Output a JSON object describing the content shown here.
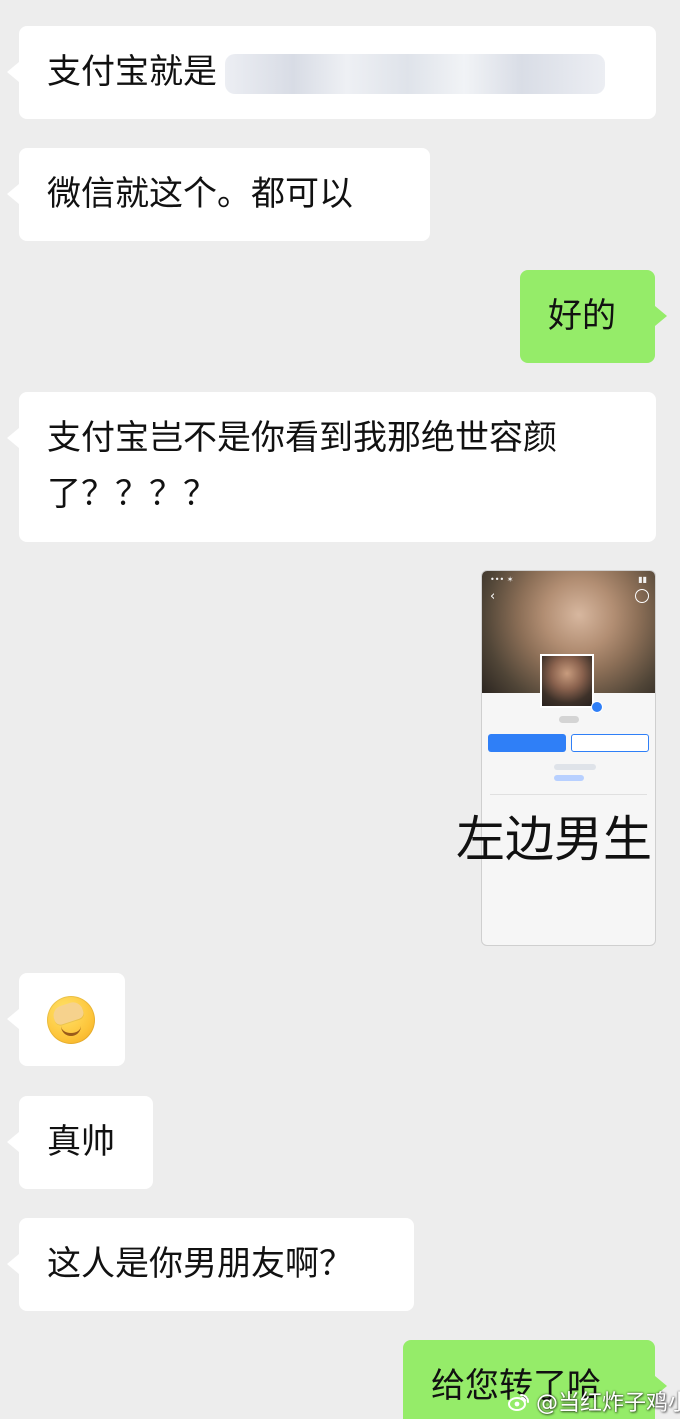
{
  "chat": {
    "messages": [
      {
        "id": "msg1",
        "side": "left",
        "text": "支付宝就是"
      },
      {
        "id": "msg2",
        "side": "left",
        "text": "微信就这个。都可以"
      },
      {
        "id": "msg3",
        "side": "right",
        "text": "好的"
      },
      {
        "id": "msg4",
        "side": "left",
        "line1": "支付宝岂不是你看到我那绝世容颜",
        "line2": "了？？？？"
      },
      {
        "id": "msg5",
        "side": "left",
        "emoji": "face-palm-emoji"
      },
      {
        "id": "msg6",
        "side": "left",
        "text": "真帅"
      },
      {
        "id": "msg7",
        "side": "left",
        "text": "这人是你男朋友啊？"
      },
      {
        "id": "msg8",
        "side": "right",
        "text": "给您转了哈"
      }
    ]
  },
  "shared_image": {
    "caption": "左边男生"
  },
  "watermark": {
    "text": "@当红炸子鸡小陈",
    "icon": "weibo-icon"
  },
  "colors": {
    "background": "#ededed",
    "incoming_bubble": "#ffffff",
    "outgoing_bubble": "#95ec69",
    "accent_blue": "#2f7ff7"
  }
}
